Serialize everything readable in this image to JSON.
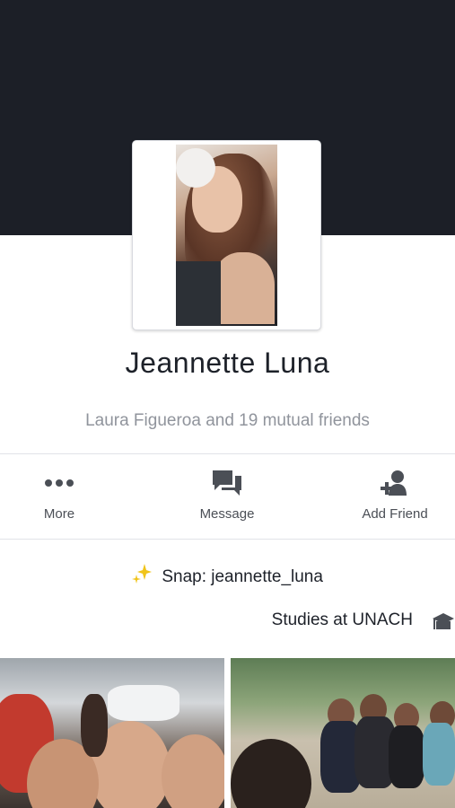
{
  "profile": {
    "name": "Jeannette Luna",
    "mutual_friends": "Laura Figueroa and 19 mutual friends"
  },
  "actions": [
    {
      "label": "Add Friend",
      "icon": "add-friend-icon"
    },
    {
      "label": "Message",
      "icon": "message-icon"
    },
    {
      "label": "More",
      "icon": "more-icon"
    }
  ],
  "intro": {
    "snap": "Snap: jeannette_luna",
    "snap_icon": "sparkle-icon",
    "studies": "Studies at UNACH",
    "studies_icon": "school-icon"
  },
  "colors": {
    "cover": "#1c1f27",
    "text": "#1d2129",
    "muted": "#90949c",
    "icon": "#4b4f56"
  }
}
